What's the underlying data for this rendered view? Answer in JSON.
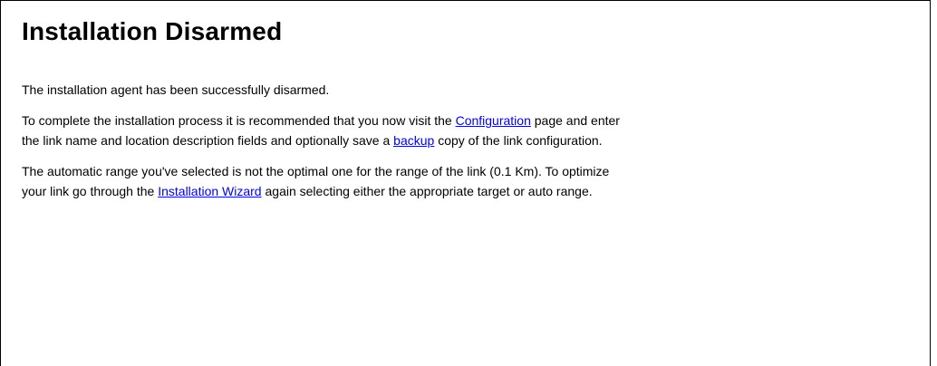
{
  "page": {
    "title": "Installation Disarmed",
    "message_success": "The installation agent has been successfully disarmed.",
    "completion": {
      "text_before_config": "To complete the installation process it is recommended that you now visit the ",
      "config_link": "Configuration",
      "text_after_config_line1": " page and enter",
      "text_line2_start": "the link name and location description fields and optionally save a ",
      "backup_link": "backup",
      "text_after_backup": " copy of the link configuration."
    },
    "range_warning": {
      "text_line1": "The automatic range you've selected is not the optimal one for the range of the link (0.1 Km). To optimize",
      "text_line2_start": "your link go through the ",
      "wizard_link": "Installation Wizard",
      "text_after_wizard": " again selecting either the appropriate target or auto range."
    }
  }
}
